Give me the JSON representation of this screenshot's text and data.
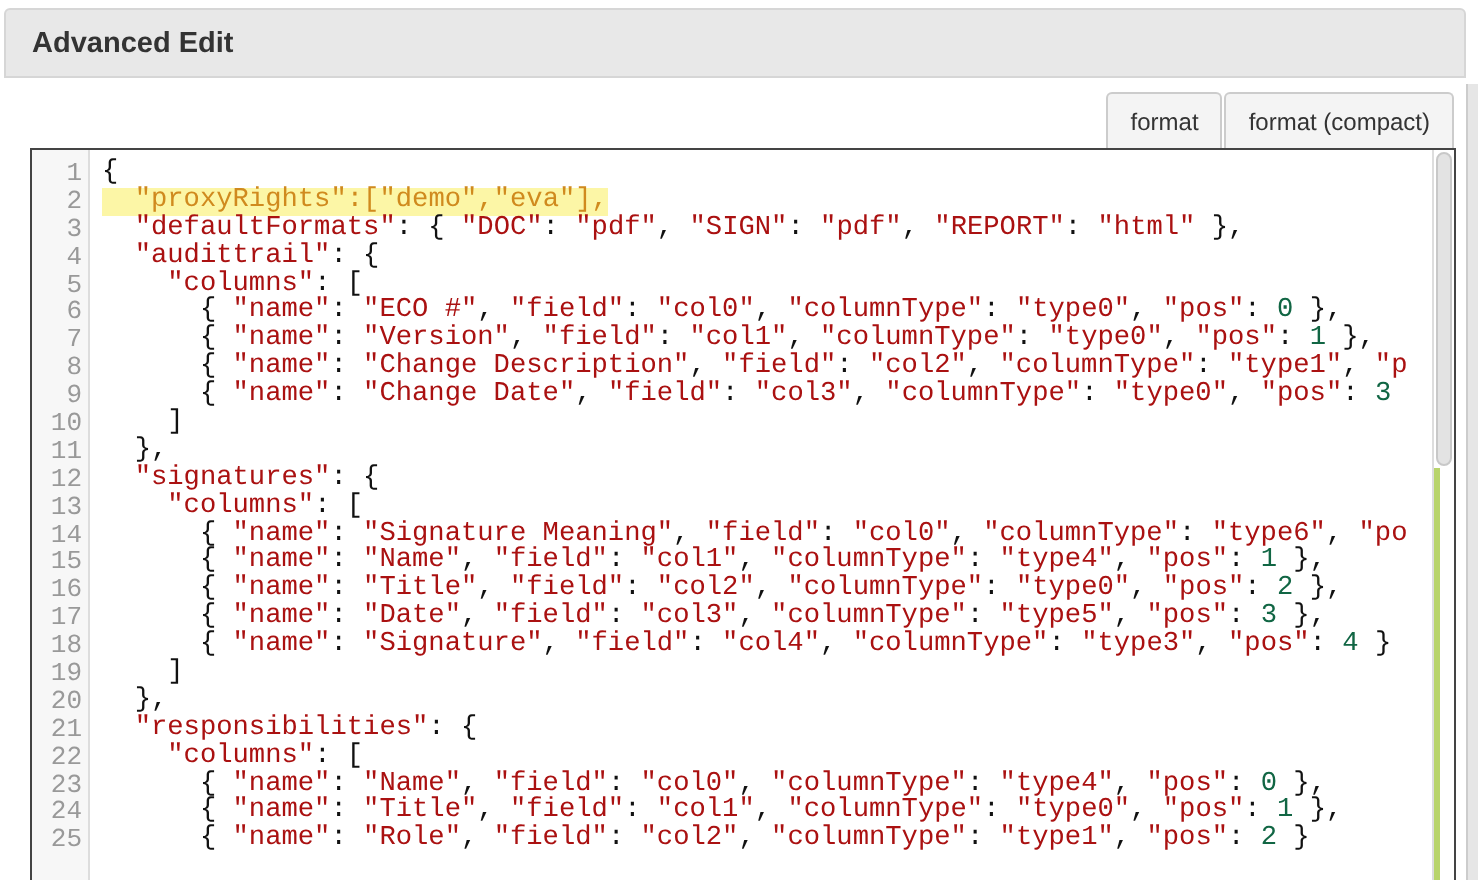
{
  "panel": {
    "title": "Advanced Edit"
  },
  "buttons": [
    {
      "label": "format"
    },
    {
      "label": "format (compact)"
    }
  ],
  "editor": {
    "lines": [
      {
        "number": "1",
        "text": "{",
        "highlighted": false
      },
      {
        "number": "2",
        "text": "  \"proxyRights\":[\"demo\",\"eva\"],",
        "highlighted": true
      },
      {
        "number": "3",
        "text": "  \"defaultFormats\": { \"DOC\": \"pdf\", \"SIGN\": \"pdf\", \"REPORT\": \"html\" },",
        "highlighted": false
      },
      {
        "number": "4",
        "text": "  \"audittrail\": {",
        "highlighted": false
      },
      {
        "number": "5",
        "text": "    \"columns\": [",
        "highlighted": false
      },
      {
        "number": "6",
        "text": "      { \"name\": \"ECO #\", \"field\": \"col0\", \"columnType\": \"type0\", \"pos\": 0 },",
        "highlighted": false
      },
      {
        "number": "7",
        "text": "      { \"name\": \"Version\", \"field\": \"col1\", \"columnType\": \"type0\", \"pos\": 1 },",
        "highlighted": false
      },
      {
        "number": "8",
        "text": "      { \"name\": \"Change Description\", \"field\": \"col2\", \"columnType\": \"type1\", \"p",
        "highlighted": false
      },
      {
        "number": "9",
        "text": "      { \"name\": \"Change Date\", \"field\": \"col3\", \"columnType\": \"type0\", \"pos\": 3",
        "highlighted": false
      },
      {
        "number": "10",
        "text": "    ]",
        "highlighted": false
      },
      {
        "number": "11",
        "text": "  },",
        "highlighted": false
      },
      {
        "number": "12",
        "text": "  \"signatures\": {",
        "highlighted": false
      },
      {
        "number": "13",
        "text": "    \"columns\": [",
        "highlighted": false
      },
      {
        "number": "14",
        "text": "      { \"name\": \"Signature Meaning\", \"field\": \"col0\", \"columnType\": \"type6\", \"po",
        "highlighted": false
      },
      {
        "number": "15",
        "text": "      { \"name\": \"Name\", \"field\": \"col1\", \"columnType\": \"type4\", \"pos\": 1 },",
        "highlighted": false
      },
      {
        "number": "16",
        "text": "      { \"name\": \"Title\", \"field\": \"col2\", \"columnType\": \"type0\", \"pos\": 2 },",
        "highlighted": false
      },
      {
        "number": "17",
        "text": "      { \"name\": \"Date\", \"field\": \"col3\", \"columnType\": \"type5\", \"pos\": 3 },",
        "highlighted": false
      },
      {
        "number": "18",
        "text": "      { \"name\": \"Signature\", \"field\": \"col4\", \"columnType\": \"type3\", \"pos\": 4 }",
        "highlighted": false
      },
      {
        "number": "19",
        "text": "    ]",
        "highlighted": false
      },
      {
        "number": "20",
        "text": "  },",
        "highlighted": false
      },
      {
        "number": "21",
        "text": "  \"responsibilities\": {",
        "highlighted": false
      },
      {
        "number": "22",
        "text": "    \"columns\": [",
        "highlighted": false
      },
      {
        "number": "23",
        "text": "      { \"name\": \"Name\", \"field\": \"col0\", \"columnType\": \"type4\", \"pos\": 0 },",
        "highlighted": false
      },
      {
        "number": "24",
        "text": "      { \"name\": \"Title\", \"field\": \"col1\", \"columnType\": \"type0\", \"pos\": 1 },",
        "highlighted": false
      },
      {
        "number": "25",
        "text": "      { \"name\": \"Role\", \"field\": \"col2\", \"columnType\": \"type1\", \"pos\": 2 }",
        "highlighted": false
      }
    ]
  }
}
